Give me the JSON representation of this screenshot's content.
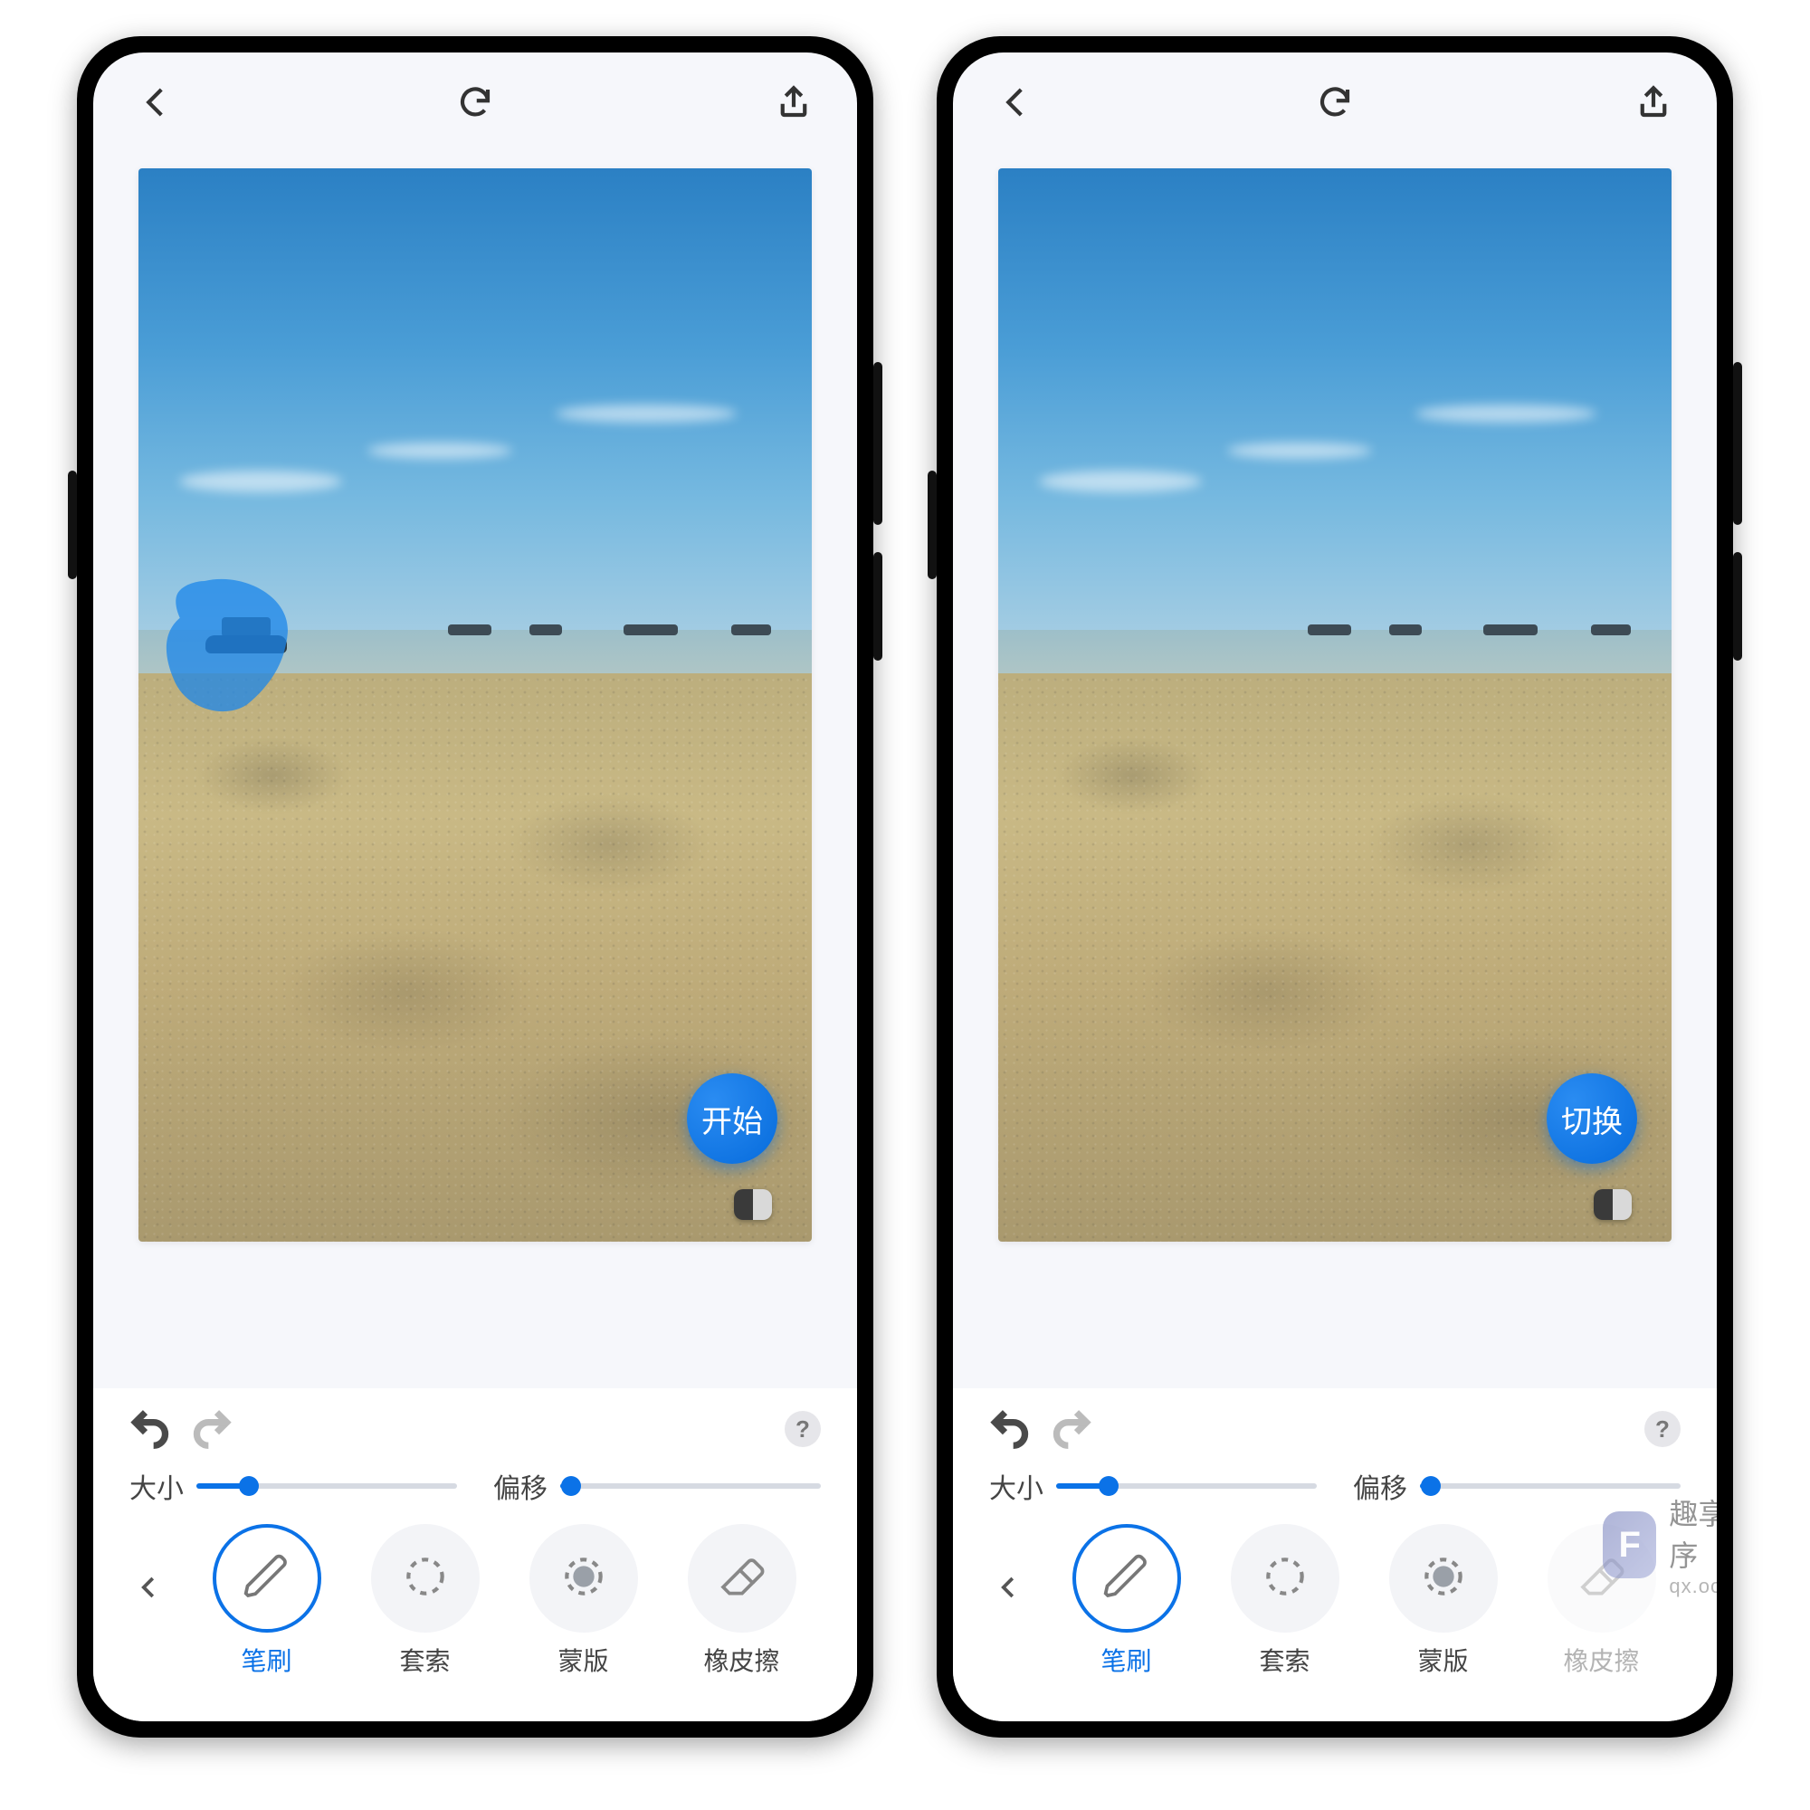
{
  "watermark": {
    "badge": "F",
    "title": "趣享小程序",
    "url": "qx.oovc.cc"
  },
  "left": {
    "fab": "开始",
    "size_label": "大小",
    "offset_label": "偏移",
    "size_value": 20,
    "offset_value": 4,
    "tools": [
      {
        "key": "brush",
        "label": "笔刷",
        "active": true
      },
      {
        "key": "lasso",
        "label": "套索",
        "active": false
      },
      {
        "key": "mask",
        "label": "蒙版",
        "active": false
      },
      {
        "key": "eraser",
        "label": "橡皮擦",
        "active": false
      }
    ],
    "help": "?"
  },
  "right": {
    "fab": "切换",
    "size_label": "大小",
    "offset_label": "偏移",
    "size_value": 20,
    "offset_value": 4,
    "tools": [
      {
        "key": "brush",
        "label": "笔刷",
        "active": true
      },
      {
        "key": "lasso",
        "label": "套索",
        "active": false
      },
      {
        "key": "mask",
        "label": "蒙版",
        "active": false
      },
      {
        "key": "eraser",
        "label": "橡皮擦",
        "active": false,
        "faded": true
      }
    ],
    "help": "?"
  },
  "colors": {
    "accent": "#0b72e7"
  }
}
